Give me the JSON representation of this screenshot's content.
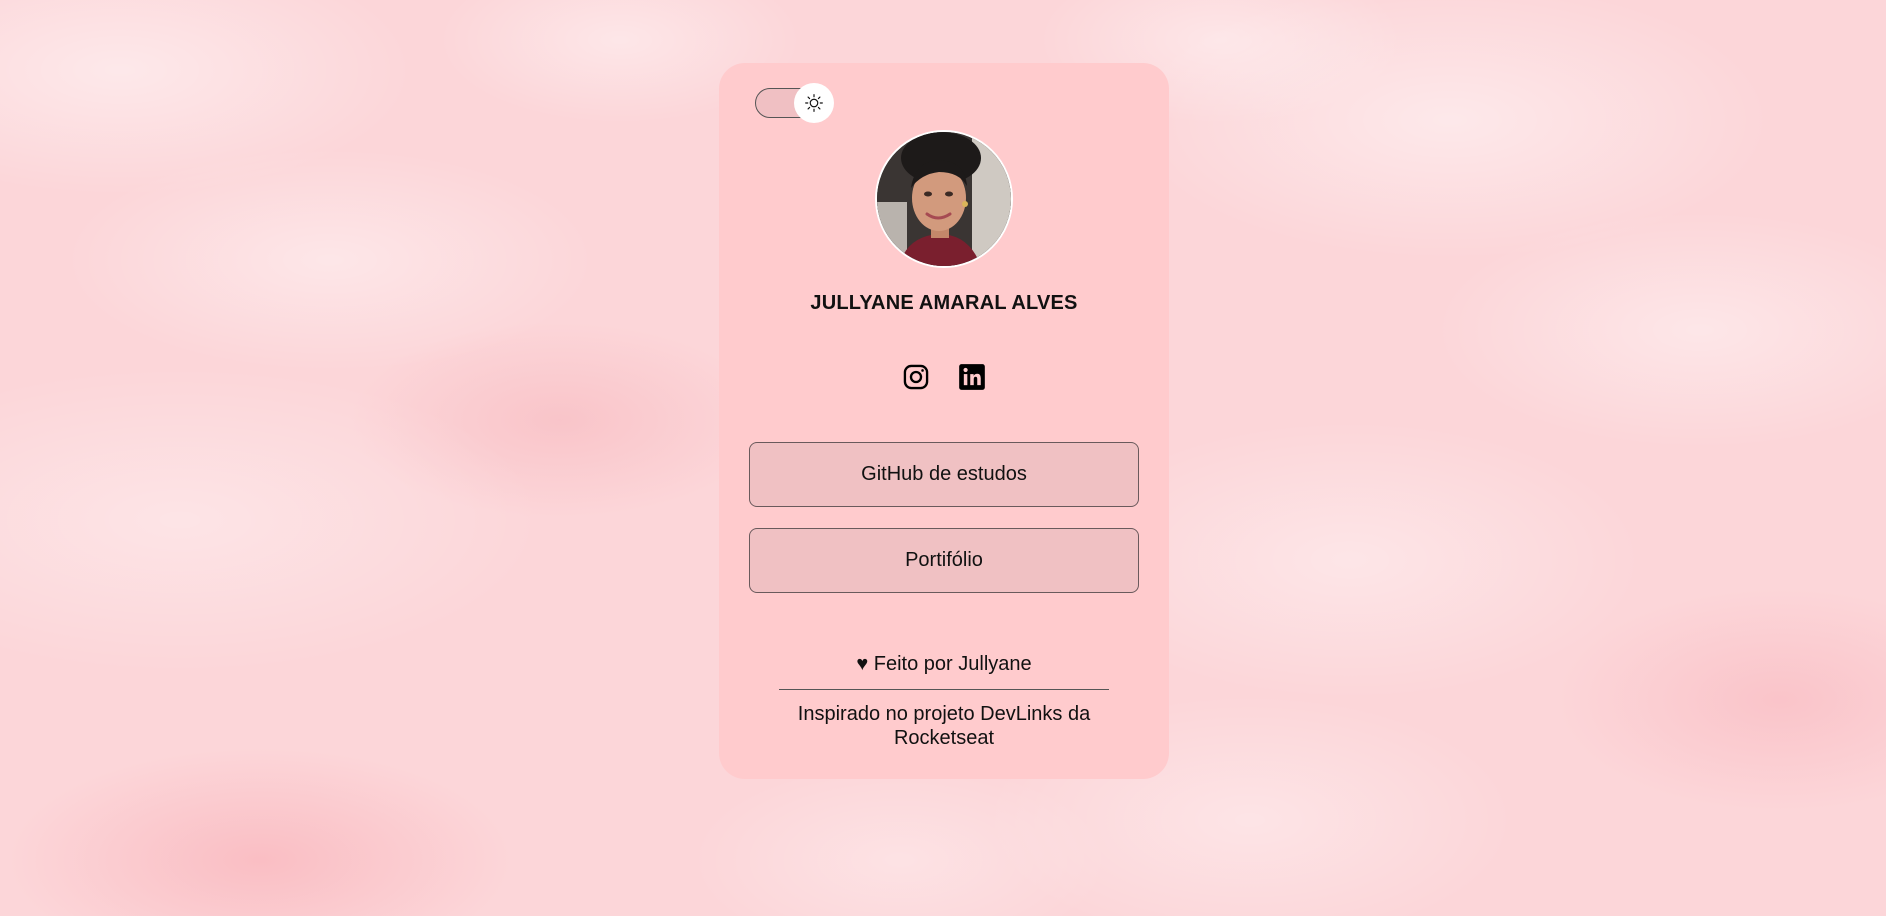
{
  "theme_toggle": {
    "icon": "sun-icon",
    "mode": "light"
  },
  "profile": {
    "name": "JULLYANE AMARAL ALVES",
    "avatar_alt": "Foto de Jullyane"
  },
  "socials": [
    {
      "icon": "instagram-icon"
    },
    {
      "icon": "linkedin-icon"
    }
  ],
  "links": [
    {
      "label": "GitHub de estudos"
    },
    {
      "label": "Portifólio"
    }
  ],
  "footer": {
    "made_by": "♥ Feito por Jullyane",
    "inspired": "Inspirado no projeto DevLinks da Rocketseat"
  },
  "colors": {
    "card": "#ffcbcd",
    "button": "#f0c1c3",
    "background": "#fcd6d9",
    "text": "#111111"
  }
}
